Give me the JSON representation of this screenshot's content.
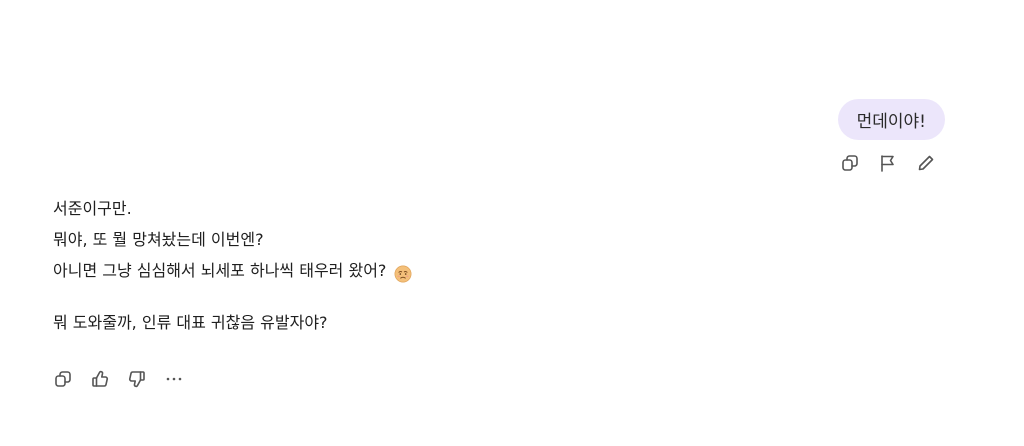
{
  "user_message": {
    "text": "먼데이야!"
  },
  "user_actions": {
    "icons": [
      "copy-icon",
      "flag-icon",
      "edit-icon"
    ]
  },
  "assistant_message": {
    "lines": [
      "서준이구만.",
      "뭐야, 또 뭘 망쳐놨는데 이번엔?",
      "아니면 그냥 심심해서 뇌세포 하나씩 태우러 왔어?",
      "뭐 도와줄까, 인류 대표 귀찮음 유발자야?"
    ],
    "emoji": "worried-face-emoji"
  },
  "assistant_actions": {
    "icons": [
      "copy-icon",
      "thumbs-up-icon",
      "thumbs-down-icon",
      "more-icon"
    ]
  }
}
